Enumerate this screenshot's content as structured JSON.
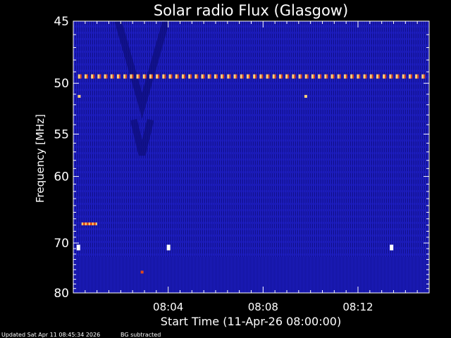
{
  "chart_data": {
    "type": "heatmap",
    "title": "Solar radio Flux (Glasgow)",
    "xlabel": "Start Time (11-Apr-26 08:00:00)",
    "ylabel": "Frequency [MHz]",
    "x_unit": "minutes after 08:00",
    "xlim": [
      0,
      15
    ],
    "ylim": [
      45,
      80
    ],
    "y_ticks": [
      "45",
      "50",
      "55",
      "60",
      "70",
      "80"
    ],
    "y_tick_values": [
      45,
      50,
      55,
      60,
      70,
      80
    ],
    "x_ticks": [
      "08:04",
      "08:08",
      "08:12"
    ],
    "x_tick_values": [
      4,
      8,
      12
    ],
    "colors": {
      "background": "#000000",
      "spectrogram_base": "#1a1ab4",
      "spectrogram_dark": "#0a0a78",
      "hot": "#ffd27a",
      "warm": "#e04a1a",
      "axis": "#ffffff"
    },
    "features": [
      {
        "kind": "periodic-line",
        "freq_mhz": 49.4,
        "x_start": 0.2,
        "x_end": 15
      },
      {
        "kind": "spot",
        "freq_mhz": 51.2,
        "x": 0.25
      },
      {
        "kind": "spot",
        "freq_mhz": 51.2,
        "x": 9.8
      },
      {
        "kind": "band-segment",
        "freq_mhz": 66.8,
        "x_start": 0.35,
        "x_end": 0.95
      },
      {
        "kind": "spot",
        "freq_mhz": 70.8,
        "x": 0.2
      },
      {
        "kind": "spot",
        "freq_mhz": 70.8,
        "x": 4.0
      },
      {
        "kind": "spot",
        "freq_mhz": 70.8,
        "x": 13.4
      },
      {
        "kind": "spot",
        "freq_mhz": 75.5,
        "x": 2.9
      }
    ]
  },
  "footer": {
    "updated": "Updated Sat Apr 11 08:45:34 2026",
    "mode": "BG subtracted"
  }
}
